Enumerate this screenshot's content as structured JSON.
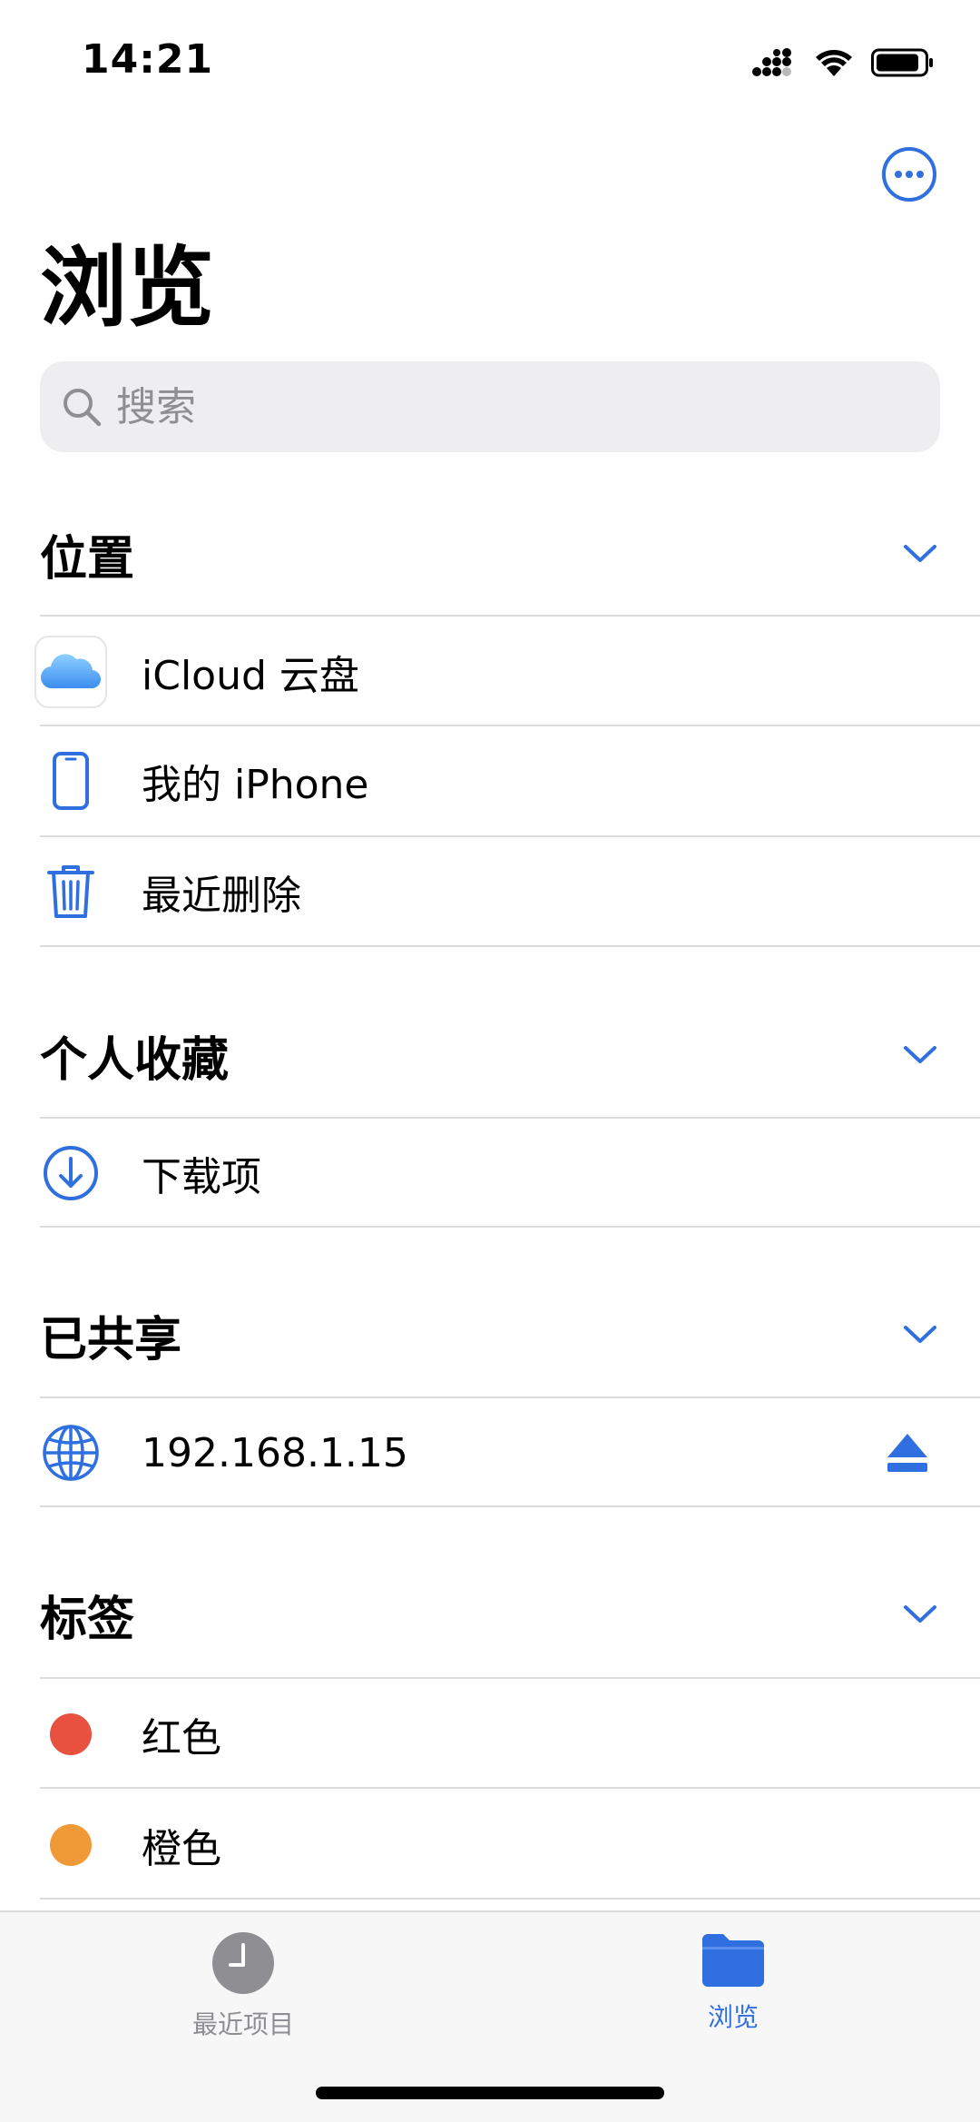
{
  "status_bar": {
    "time": "14:21"
  },
  "colors": {
    "accent": "#2f6fe0",
    "red_tag": "#e8503f",
    "orange_tag": "#f09a37",
    "gray_tab": "#8e8e93"
  },
  "header": {
    "title": "浏览",
    "more_icon": "ellipsis-circle-icon"
  },
  "search": {
    "placeholder": "搜索",
    "value": ""
  },
  "sections": {
    "locations": {
      "title": "位置",
      "items": [
        {
          "label": "iCloud 云盘",
          "icon": "icloud-icon"
        },
        {
          "label": "我的 iPhone",
          "icon": "iphone-icon"
        },
        {
          "label": "最近删除",
          "icon": "trash-icon"
        }
      ]
    },
    "favorites": {
      "title": "个人收藏",
      "items": [
        {
          "label": "下载项",
          "icon": "download-circle-icon"
        }
      ]
    },
    "shared": {
      "title": "已共享",
      "items": [
        {
          "label": "192.168.1.15",
          "icon": "globe-icon",
          "accessory": "eject-icon"
        }
      ]
    },
    "tags": {
      "title": "标签",
      "items": [
        {
          "label": "红色",
          "color": "#e8503f"
        },
        {
          "label": "橙色",
          "color": "#f09a37"
        }
      ]
    }
  },
  "tab_bar": {
    "tabs": [
      {
        "label": "最近项目",
        "icon": "clock-icon",
        "selected": false
      },
      {
        "label": "浏览",
        "icon": "folder-icon",
        "selected": true
      }
    ]
  }
}
